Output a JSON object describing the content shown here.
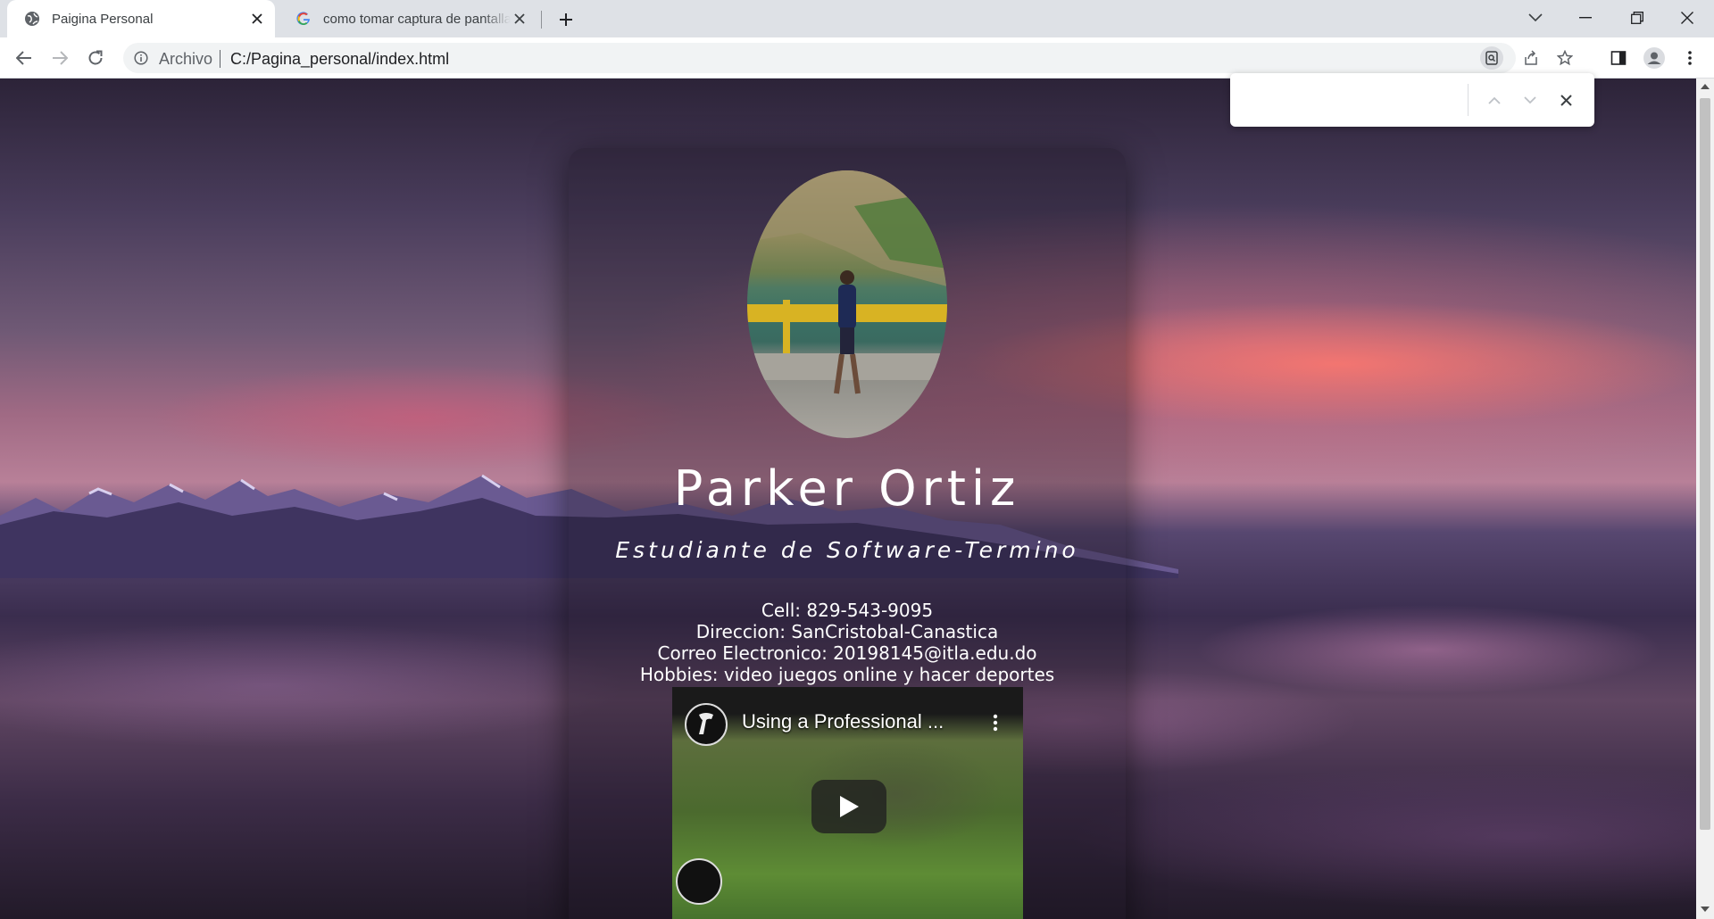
{
  "browser": {
    "tabs": [
      {
        "title": "Paigina Personal",
        "icon": "globe-icon",
        "active": true
      },
      {
        "title": "como tomar captura de pantalla en",
        "icon": "google-icon",
        "active": false
      }
    ],
    "address": {
      "scheme_label": "Archivo",
      "url": "C:/Pagina_personal/index.html"
    }
  },
  "find_bar": {
    "query": ""
  },
  "profile": {
    "name": "Parker Ortiz",
    "subtitle": "Estudiante de Software-Termino",
    "details": [
      "Cell: 829-543-9095",
      "Direccion: SanCristobal-Canastica",
      "Correo Electronico: 20198145@itla.edu.do",
      "Hobbies: video juegos online y hacer deportes"
    ]
  },
  "video": {
    "title": "Using a Professional ..."
  },
  "colors": {
    "tabbar": "#dee1e6",
    "toolbar": "#ffffff",
    "text_light": "#ffffff"
  }
}
